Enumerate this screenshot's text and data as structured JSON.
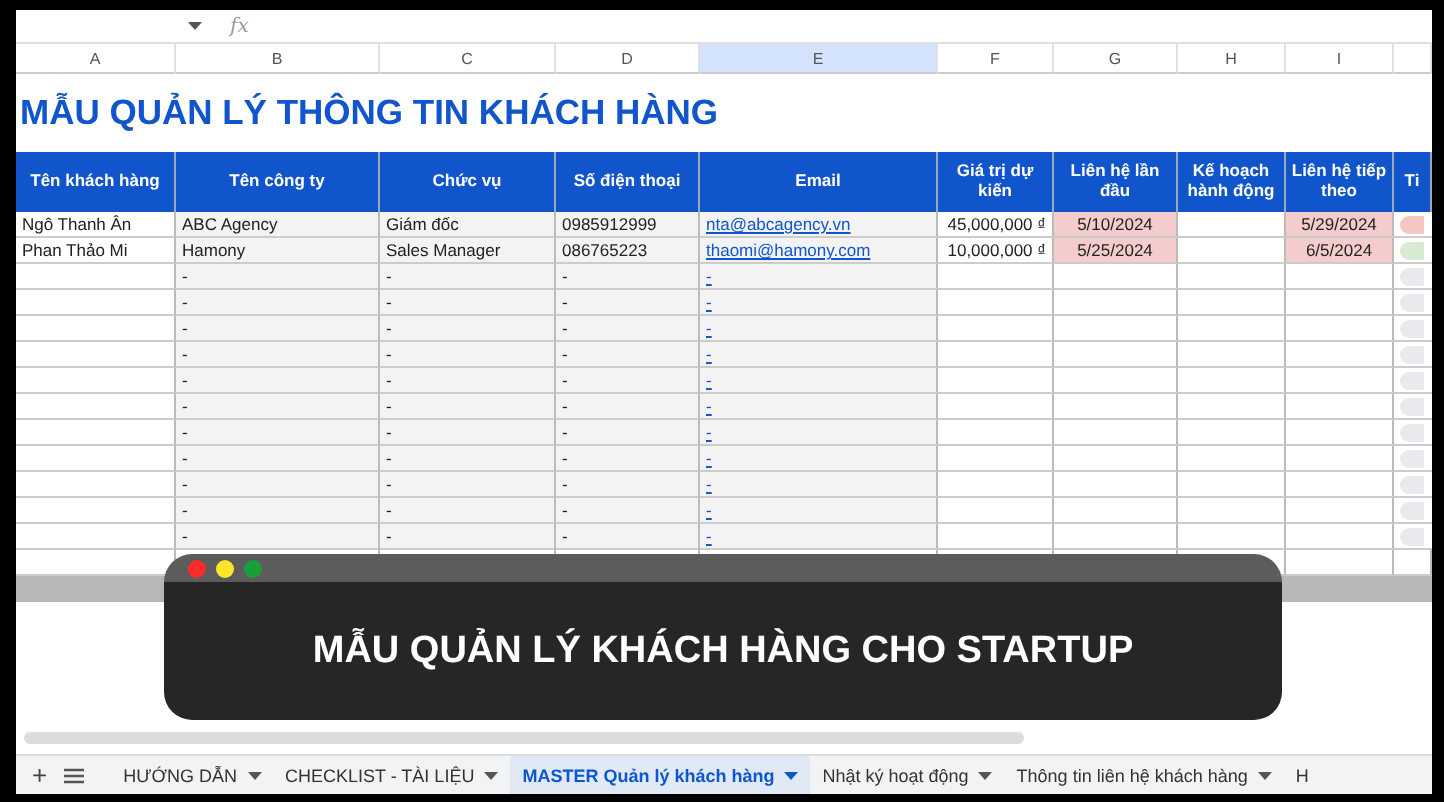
{
  "formula_bar": {
    "fx": "fx"
  },
  "columns": [
    "A",
    "B",
    "C",
    "D",
    "E",
    "F",
    "G",
    "H",
    "I",
    ""
  ],
  "title": "MẪU QUẢN LÝ THÔNG TIN KHÁCH HÀNG",
  "headers": [
    "Tên khách hàng",
    "Tên công ty",
    "Chức vụ",
    "Số điện thoại",
    "Email",
    "Giá trị dự kiến",
    "Liên hệ lần đầu",
    "Kế hoạch hành động",
    "Liên hệ tiếp theo",
    "Ti"
  ],
  "rows": [
    {
      "name": "Ngô Thanh Ân",
      "company": "ABC Agency",
      "position": "Giám đốc",
      "phone": "0985912999",
      "email": "nta@abcagency.vn",
      "value": "45,000,000 ₫",
      "first_contact": "5/10/2024",
      "plan": "",
      "next_contact": "5/29/2024",
      "color": "#f4c7c3"
    },
    {
      "name": "Phan Thảo Mi",
      "company": "Hamony",
      "position": "Sales Manager",
      "phone": "086765223",
      "email": "thaomi@hamony.com",
      "value": "10,000,000 ₫",
      "first_contact": "5/25/2024",
      "plan": "",
      "next_contact": "6/5/2024",
      "color": "#d9ead3"
    },
    {
      "name": "",
      "company": "-",
      "position": "-",
      "phone": "-",
      "email": "-",
      "value": "",
      "first_contact": "",
      "plan": "",
      "next_contact": "",
      "color": "#e8eaed"
    },
    {
      "name": "",
      "company": "-",
      "position": "-",
      "phone": "-",
      "email": "-",
      "value": "",
      "first_contact": "",
      "plan": "",
      "next_contact": "",
      "color": "#e8eaed"
    },
    {
      "name": "",
      "company": "-",
      "position": "-",
      "phone": "-",
      "email": "-",
      "value": "",
      "first_contact": "",
      "plan": "",
      "next_contact": "",
      "color": "#e8eaed"
    },
    {
      "name": "",
      "company": "-",
      "position": "-",
      "phone": "-",
      "email": "-",
      "value": "",
      "first_contact": "",
      "plan": "",
      "next_contact": "",
      "color": "#e8eaed"
    },
    {
      "name": "",
      "company": "-",
      "position": "-",
      "phone": "-",
      "email": "-",
      "value": "",
      "first_contact": "",
      "plan": "",
      "next_contact": "",
      "color": "#e8eaed"
    },
    {
      "name": "",
      "company": "-",
      "position": "-",
      "phone": "-",
      "email": "-",
      "value": "",
      "first_contact": "",
      "plan": "",
      "next_contact": "",
      "color": "#e8eaed"
    },
    {
      "name": "",
      "company": "-",
      "position": "-",
      "phone": "-",
      "email": "-",
      "value": "",
      "first_contact": "",
      "plan": "",
      "next_contact": "",
      "color": "#e8eaed"
    },
    {
      "name": "",
      "company": "-",
      "position": "-",
      "phone": "-",
      "email": "-",
      "value": "",
      "first_contact": "",
      "plan": "",
      "next_contact": "",
      "color": "#e8eaed"
    },
    {
      "name": "",
      "company": "-",
      "position": "-",
      "phone": "-",
      "email": "-",
      "value": "",
      "first_contact": "",
      "plan": "",
      "next_contact": "",
      "color": "#e8eaed"
    },
    {
      "name": "",
      "company": "-",
      "position": "-",
      "phone": "-",
      "email": "-",
      "value": "",
      "first_contact": "",
      "plan": "",
      "next_contact": "",
      "color": "#e8eaed"
    },
    {
      "name": "",
      "company": "-",
      "position": "-",
      "phone": "-",
      "email": "-",
      "value": "",
      "first_contact": "",
      "plan": "",
      "next_contact": "",
      "color": "#e8eaed"
    }
  ],
  "banner": {
    "title": "MẪU QUẢN LÝ KHÁCH HÀNG CHO STARTUP"
  },
  "sheet_tabs": {
    "add": "+",
    "tabs": [
      {
        "label": "HƯỚNG DẪN",
        "selected": false
      },
      {
        "label": "CHECKLIST - TÀI LIỆU",
        "selected": false
      },
      {
        "label": "MASTER Quản lý khách hàng",
        "selected": true
      },
      {
        "label": "Nhật ký hoạt động",
        "selected": false
      },
      {
        "label": "Thông tin liên hệ khách hàng",
        "selected": false
      },
      {
        "label": "H",
        "selected": false
      }
    ]
  }
}
